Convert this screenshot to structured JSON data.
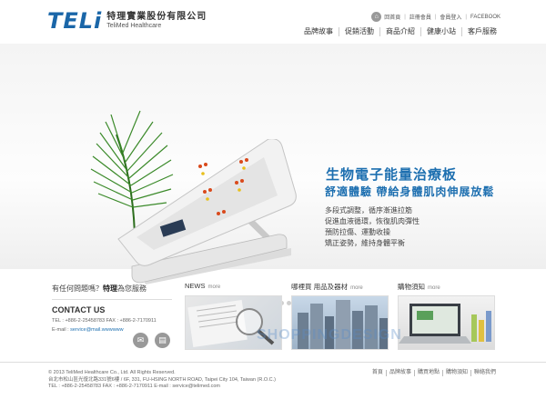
{
  "header": {
    "logo_mark": "TELi",
    "company_cn": "特理實業股份有限公司",
    "company_en": "TeliMed Healthcare",
    "top_links": [
      "回首頁",
      "註冊會員",
      "會員登入",
      "FACEBOOK"
    ],
    "nav": [
      "品牌故事",
      "促銷活動",
      "商品介紹",
      "健康小站",
      "客戶服務"
    ]
  },
  "banner": {
    "headline": "生物電子能量治療板",
    "subheadline": "舒適體驗 帶給身體肌肉伸展放鬆",
    "features": [
      "多段式調整，循序漸進拉筋",
      "促進血液循環，恢復肌肉彈性",
      "預防拉傷、運動收操",
      "矯正姿勢，維持身體平衡"
    ],
    "slide_count": 5,
    "active_slide": 1
  },
  "contact": {
    "question_prefix": "有任何問題嗎？",
    "question_brand": "特理",
    "question_suffix": "為您服務",
    "heading": "CONTACT US",
    "tel_line": "TEL : +886-2-25458783   FAX : +886-2-7170911",
    "email_label": "E-mail : ",
    "email": "service@mail.wwwwww"
  },
  "cards": [
    {
      "title": "NEWS",
      "more": "more"
    },
    {
      "title": "哪裡買 用品及器材",
      "more": "more"
    },
    {
      "title": "購物須知",
      "more": "more"
    }
  ],
  "watermark": "SHOPPINGDESIGN",
  "footer": {
    "copyright": "© 2013 TeliMed Healthcare Co., Ltd. All Rights Reserved.",
    "address": "台北市松山區光復北路331號6樓 / 6F, 331, FU-HSING NORTH ROAD, Taipei City 104, Taiwan (R.O.C.)",
    "contact": "TEL : +886-2-25458783   FAX : +886-2-7170911   E-mail : service@telimed.com",
    "links": [
      "首頁",
      "品牌故事",
      "購買地點",
      "購物須知",
      "聯絡我們"
    ]
  }
}
